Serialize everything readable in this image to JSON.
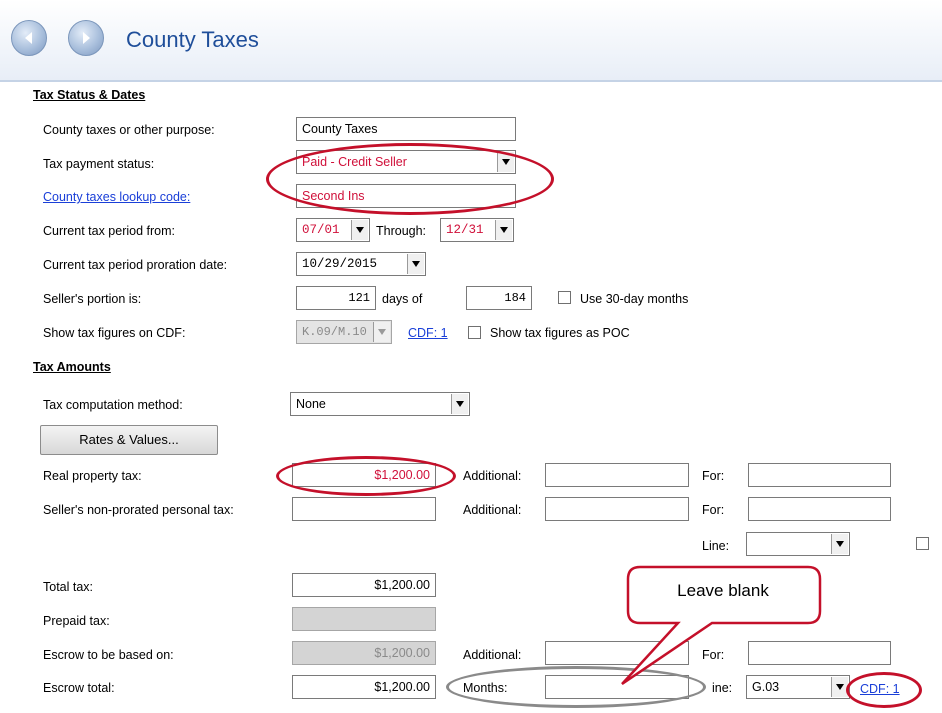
{
  "header": {
    "title": "County Taxes"
  },
  "tax_status": {
    "section_title": "Tax Status & Dates",
    "purpose_label": "County taxes or other purpose:",
    "purpose_value": "County Taxes",
    "status_label": "Tax payment status:",
    "status_value": "Paid - Credit Seller",
    "lookup_label": "County taxes lookup code:",
    "lookup_value": "Second Ins",
    "period_from_label": "Current tax period from:",
    "period_from_value": "07/01",
    "through_label": "Through:",
    "through_value": "12/31",
    "proration_label": "Current tax period proration date:",
    "proration_value": "10/29/2015",
    "seller_portion_label": "Seller's portion is:",
    "seller_days": "121",
    "days_of_label": "days of",
    "total_days": "184",
    "use_30_day_label": "Use 30-day months",
    "show_cdf_label": "Show tax figures on CDF:",
    "show_cdf_value": "K.09/M.10",
    "cdf_link": "CDF: 1",
    "show_poc_label": "Show tax figures as POC"
  },
  "tax_amounts": {
    "section_title": "Tax Amounts",
    "method_label": "Tax computation method:",
    "method_value": "None",
    "rates_button": "Rates & Values...",
    "real_property_label": "Real property tax:",
    "real_property_value": "$1,200.00",
    "additional_label": "Additional:",
    "for_label": "For:",
    "personal_tax_label": "Seller's non-prorated personal tax:",
    "line_label": "Line:",
    "total_tax_label": "Total tax:",
    "total_tax_value": "$1,200.00",
    "prepaid_label": "Prepaid tax:",
    "escrow_based_label": "Escrow to be based on:",
    "escrow_based_value": "$1,200.00",
    "escrow_total_label": "Escrow total:",
    "escrow_total_value": "$1,200.00",
    "months_label": "Months:",
    "line_label_partial": "ine:",
    "line_value": "G.03",
    "cdf_link": "CDF: 1"
  },
  "callout": {
    "text": "Leave blank"
  },
  "colors": {
    "highlight_ring": "#c4102a",
    "highlight_text": "#d0103a",
    "link": "#1a3fd8",
    "title": "#1f4e9a"
  }
}
